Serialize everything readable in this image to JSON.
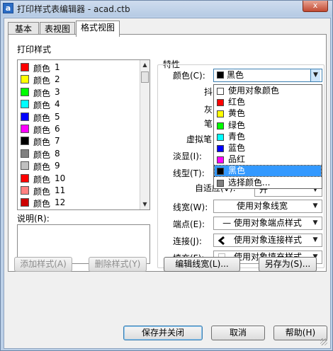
{
  "window": {
    "app_icon_letter": "a",
    "title": "打印样式表编辑器 - acad.ctb",
    "close_label": "x"
  },
  "tabs": [
    {
      "label": "基本",
      "active": false
    },
    {
      "label": "表视图",
      "active": false
    },
    {
      "label": "格式视图",
      "active": true
    }
  ],
  "print_styles": {
    "label": "打印样式",
    "items": [
      {
        "name": "颜色",
        "num": "1",
        "color": "#ff0000"
      },
      {
        "name": "颜色",
        "num": "2",
        "color": "#ffff00"
      },
      {
        "name": "颜色",
        "num": "3",
        "color": "#00ff00"
      },
      {
        "name": "颜色",
        "num": "4",
        "color": "#00ffff"
      },
      {
        "name": "颜色",
        "num": "5",
        "color": "#0000ff"
      },
      {
        "name": "颜色",
        "num": "6",
        "color": "#ff00ff"
      },
      {
        "name": "颜色",
        "num": "7",
        "color": "#000000"
      },
      {
        "name": "颜色",
        "num": "8",
        "color": "#808080"
      },
      {
        "name": "颜色",
        "num": "9",
        "color": "#c0c0c0"
      },
      {
        "name": "颜色",
        "num": "10",
        "color": "#ff0000"
      },
      {
        "name": "颜色",
        "num": "11",
        "color": "#ff8080"
      },
      {
        "name": "颜色",
        "num": "12",
        "color": "#cc0000"
      }
    ]
  },
  "description": {
    "label": "说明(R):",
    "value": ""
  },
  "properties": {
    "group_label": "特性",
    "color_label": "颜色(C):",
    "color_value": "黑色",
    "color_swatch": "#000000",
    "dither_label": "抖",
    "gray_label": "灰",
    "pen_label": "笔",
    "virtual_pen_label": "虚拟笔",
    "screening_label": "淡显(I):",
    "linetype_label": "线型(T):",
    "adaptive_label": "自适应(V):",
    "adaptive_value": "开",
    "lineweight_label": "线宽(W):",
    "lineweight_value": "使用对象线宽",
    "lineend_label": "端点(E):",
    "lineend_value": "— 使用对象端点样式",
    "linejoin_label": "连接(J):",
    "linejoin_value": "使用对象连接样式",
    "fill_label": "填充(F):",
    "fill_value": "使用对象填充样式"
  },
  "color_dropdown": {
    "items": [
      {
        "label": "使用对象颜色",
        "swatch": "#ffffff",
        "selected": false
      },
      {
        "label": "红色",
        "swatch": "#ff0000",
        "selected": false
      },
      {
        "label": "黄色",
        "swatch": "#ffff00",
        "selected": false
      },
      {
        "label": "绿色",
        "swatch": "#00ff00",
        "selected": false
      },
      {
        "label": "青色",
        "swatch": "#00ffff",
        "selected": false
      },
      {
        "label": "蓝色",
        "swatch": "#0000ff",
        "selected": false
      },
      {
        "label": "品红",
        "swatch": "#ff00ff",
        "selected": false
      },
      {
        "label": "黑色",
        "swatch": "#000000",
        "selected": true
      },
      {
        "label": "选择颜色...",
        "swatch": "#808080",
        "selected": false
      }
    ]
  },
  "buttons": {
    "add_style": "添加样式(A)",
    "delete_style": "删除样式(Y)",
    "edit_lineweights": "编辑线宽(L)...",
    "save_as": "另存为(S)...",
    "save_close": "保存并关闭",
    "cancel": "取消",
    "help": "帮助(H)"
  }
}
